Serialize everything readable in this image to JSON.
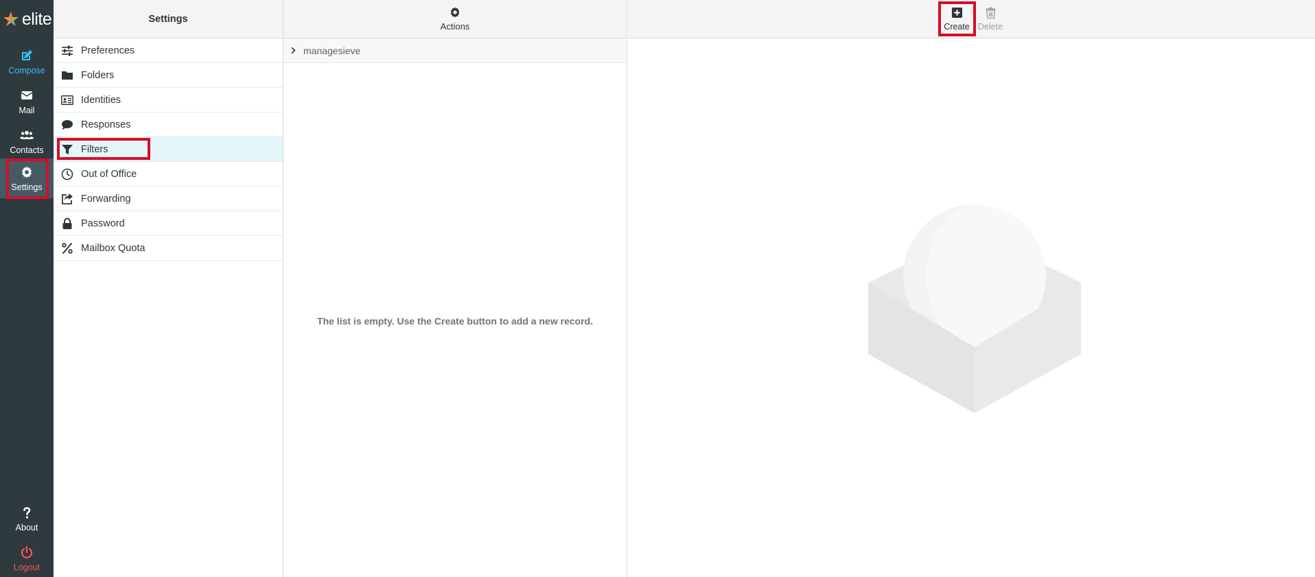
{
  "app": {
    "logo_text": "elite"
  },
  "nav": {
    "items": [
      {
        "id": "compose",
        "label": "Compose",
        "icon": "compose-icon"
      },
      {
        "id": "mail",
        "label": "Mail",
        "icon": "envelope-icon"
      },
      {
        "id": "contacts",
        "label": "Contacts",
        "icon": "users-icon"
      },
      {
        "id": "settings",
        "label": "Settings",
        "icon": "gear-icon"
      },
      {
        "id": "about",
        "label": "About",
        "icon": "question-icon"
      },
      {
        "id": "logout",
        "label": "Logout",
        "icon": "power-icon"
      }
    ]
  },
  "settings_col": {
    "title": "Settings",
    "items": [
      {
        "label": "Preferences",
        "icon": "sliders-icon"
      },
      {
        "label": "Folders",
        "icon": "folder-icon"
      },
      {
        "label": "Identities",
        "icon": "id-card-icon"
      },
      {
        "label": "Responses",
        "icon": "comment-icon"
      },
      {
        "label": "Filters",
        "icon": "filter-icon",
        "selected": true
      },
      {
        "label": "Out of Office",
        "icon": "clock-icon"
      },
      {
        "label": "Forwarding",
        "icon": "share-icon"
      },
      {
        "label": "Password",
        "icon": "lock-icon"
      },
      {
        "label": "Mailbox Quota",
        "icon": "percent-icon"
      }
    ]
  },
  "sets_col": {
    "actions_label": "Actions",
    "filter_set": "managesieve",
    "empty_message": "The list is empty. Use the Create button to add a new record."
  },
  "toolbar": {
    "create_label": "Create",
    "delete_label": "Delete"
  },
  "colors": {
    "nav_bg": "#2f3a3f",
    "accent": "#37beff",
    "logout": "#ff5552",
    "highlight": "#d40e28",
    "selected_row": "#e5f6fb"
  }
}
